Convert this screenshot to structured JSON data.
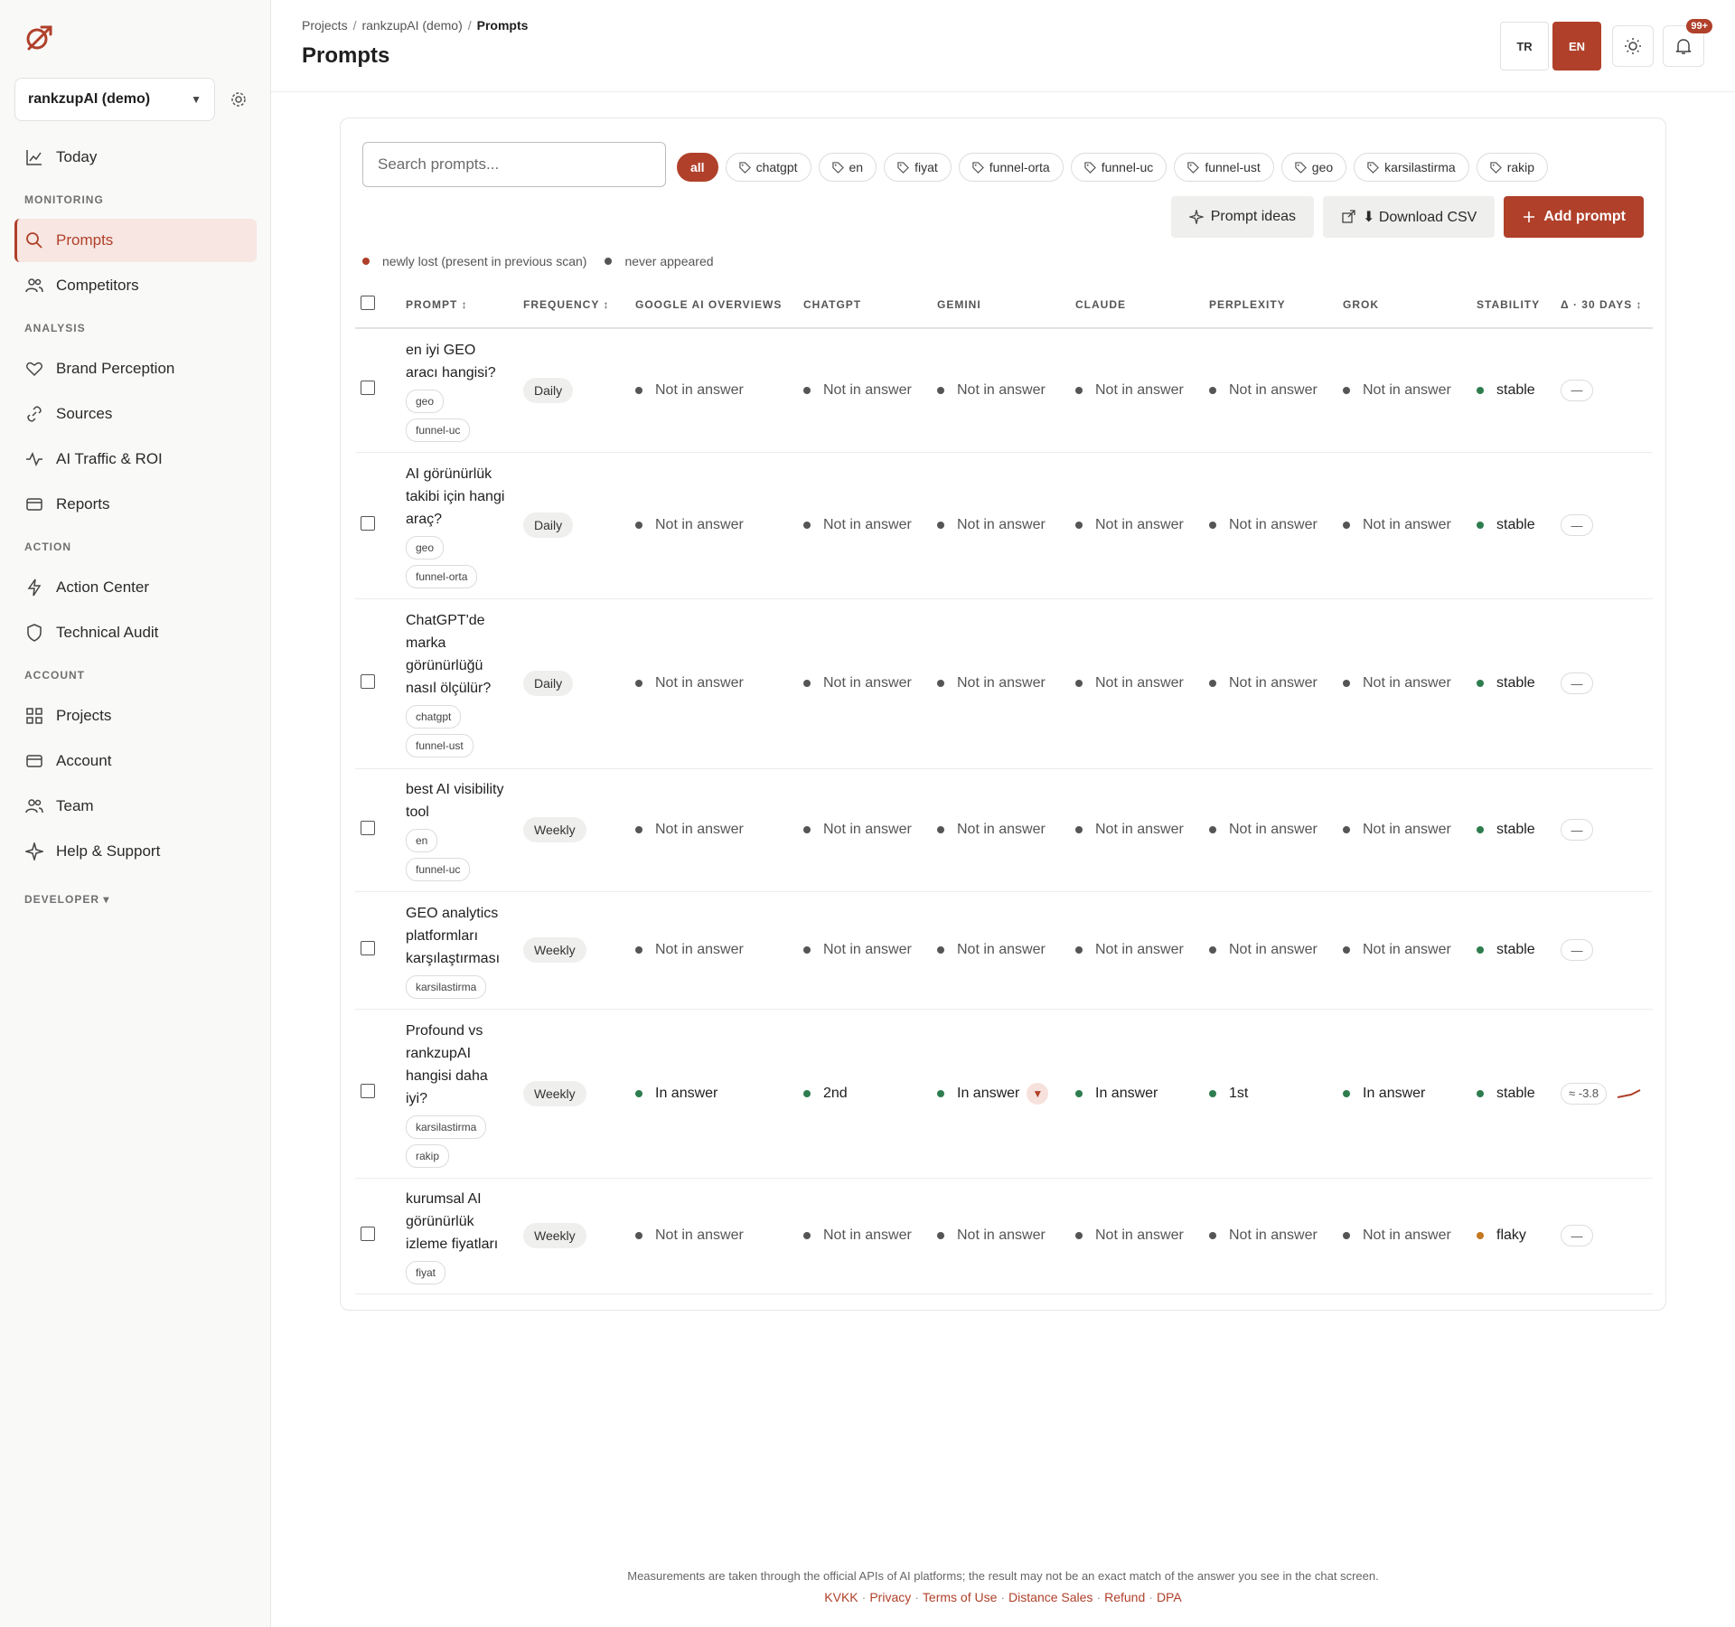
{
  "sidebar": {
    "project_name": "rankzupAI (demo)",
    "nav": {
      "today": "Today",
      "monitoring": "MONITORING",
      "prompts": "Prompts",
      "competitors": "Competitors",
      "analysis": "ANALYSIS",
      "brand_perception": "Brand Perception",
      "sources": "Sources",
      "ai_traffic": "AI Traffic & ROI",
      "reports": "Reports",
      "action": "ACTION",
      "action_center": "Action Center",
      "technical_audit": "Technical Audit",
      "account_section": "ACCOUNT",
      "projects": "Projects",
      "account": "Account",
      "team": "Team",
      "help": "Help & Support",
      "developer": "DEVELOPER ▾"
    }
  },
  "header": {
    "crumbs": [
      "Projects",
      "rankzupAI (demo)",
      "Prompts"
    ],
    "title": "Prompts",
    "lang_tr": "TR",
    "lang_en": "EN",
    "notif_badge": "99+"
  },
  "toolbar": {
    "search_placeholder": "Search prompts...",
    "filters": [
      "all",
      "chatgpt",
      "en",
      "fiyat",
      "funnel-orta",
      "funnel-uc",
      "funnel-ust",
      "geo",
      "karsilastirma",
      "rakip"
    ],
    "prompt_ideas": "Prompt ideas",
    "download_csv": "⬇ Download CSV",
    "add_prompt": "Add prompt"
  },
  "legend": {
    "newly_lost": "newly lost (present in previous scan)",
    "never_appeared": "never appeared"
  },
  "table": {
    "headers": [
      "PROMPT ↕",
      "FREQUENCY ↕",
      "GOOGLE AI OVERVIEWS",
      "CHATGPT",
      "GEMINI",
      "CLAUDE",
      "PERPLEXITY",
      "GROK",
      "STABILITY",
      "Δ · 30 DAYS ↕"
    ],
    "rows": [
      {
        "prompt": "en iyi GEO aracı hangisi?",
        "tags": [
          "geo",
          "funnel-uc"
        ],
        "frequency": "Daily",
        "google": "Not in answer",
        "chatgpt": "Not in answer",
        "gemini": "Not in answer",
        "claude": "Not in answer",
        "perplexity": "Not in answer",
        "grok": "Not in answer",
        "stability": "stable",
        "delta": "—"
      },
      {
        "prompt": "AI görünürlük takibi için hangi araç?",
        "tags": [
          "geo",
          "funnel-orta"
        ],
        "frequency": "Daily",
        "google": "Not in answer",
        "chatgpt": "Not in answer",
        "gemini": "Not in answer",
        "claude": "Not in answer",
        "perplexity": "Not in answer",
        "grok": "Not in answer",
        "stability": "stable",
        "delta": "—"
      },
      {
        "prompt": "ChatGPT'de marka görünürlüğü nasıl ölçülür?",
        "tags": [
          "chatgpt",
          "funnel-ust"
        ],
        "frequency": "Daily",
        "google": "Not in answer",
        "chatgpt": "Not in answer",
        "gemini": "Not in answer",
        "claude": "Not in answer",
        "perplexity": "Not in answer",
        "grok": "Not in answer",
        "stability": "stable",
        "delta": "—"
      },
      {
        "prompt": "best AI visibility tool",
        "tags": [
          "en",
          "funnel-uc"
        ],
        "frequency": "Weekly",
        "google": "Not in answer",
        "chatgpt": "Not in answer",
        "gemini": "Not in answer",
        "claude": "Not in answer",
        "perplexity": "Not in answer",
        "grok": "Not in answer",
        "stability": "stable",
        "delta": "—"
      },
      {
        "prompt": "GEO analytics platformları karşılaştırması",
        "tags": [
          "karsilastirma"
        ],
        "frequency": "Weekly",
        "google": "Not in answer",
        "chatgpt": "Not in answer",
        "gemini": "Not in answer",
        "claude": "Not in answer",
        "perplexity": "Not in answer",
        "grok": "Not in answer",
        "stability": "stable",
        "delta": "—"
      },
      {
        "prompt": "Profound vs rankzupAI hangisi daha iyi?",
        "tags": [
          "karsilastirma",
          "rakip"
        ],
        "frequency": "Weekly",
        "google": "In answer",
        "chatgpt": "2nd",
        "gemini": "In answer",
        "claude": "In answer",
        "perplexity": "1st",
        "grok": "In answer",
        "stability": "stable",
        "delta": "≈ -3.8"
      },
      {
        "prompt": "kurumsal AI görünürlük izleme fiyatları",
        "tags": [
          "fiyat"
        ],
        "frequency": "Weekly",
        "google": "Not in answer",
        "chatgpt": "Not in answer",
        "gemini": "Not in answer",
        "claude": "Not in answer",
        "perplexity": "Not in answer",
        "grok": "Not in answer",
        "stability": "flaky",
        "delta": "—"
      }
    ]
  },
  "footer": {
    "disclaimer": "Measurements are taken through the official APIs of AI platforms; the result may not be an exact match of the answer you see in the chat screen.",
    "links": [
      "KVKK",
      "Privacy",
      "Terms of Use",
      "Distance Sales",
      "Refund",
      "DPA"
    ]
  },
  "colors": {
    "accent": "#b0402a",
    "in_answer": "#2e7d4f",
    "flaky": "#c4781f"
  }
}
